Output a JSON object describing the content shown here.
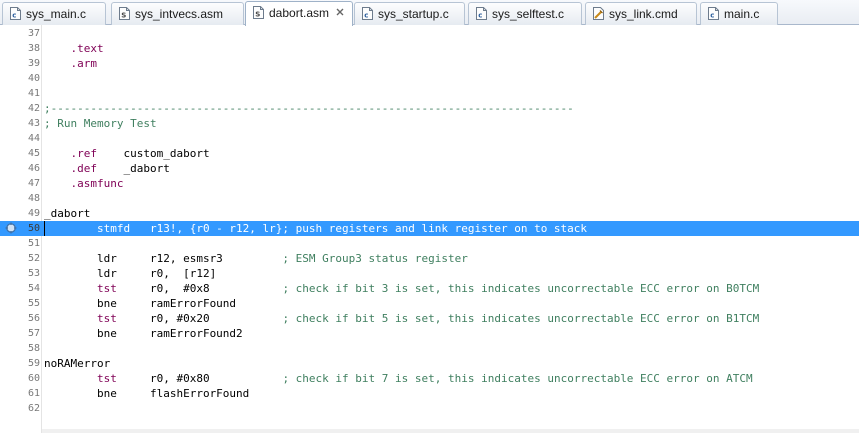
{
  "tabs": [
    {
      "label": "sys_main.c",
      "icon": "c-file-icon",
      "active": false,
      "closable": false
    },
    {
      "label": "sys_intvecs.asm",
      "icon": "asm-file-icon",
      "active": false,
      "closable": false
    },
    {
      "label": "dabort.asm",
      "icon": "asm-file-icon",
      "active": true,
      "closable": true
    },
    {
      "label": "sys_startup.c",
      "icon": "c-file-icon",
      "active": false,
      "closable": false
    },
    {
      "label": "sys_selftest.c",
      "icon": "c-file-icon",
      "active": false,
      "closable": false
    },
    {
      "label": "sys_link.cmd",
      "icon": "linker-cmd-file-icon",
      "active": false,
      "closable": false
    },
    {
      "label": "main.c",
      "icon": "c-file-icon",
      "active": false,
      "closable": false
    }
  ],
  "colors": {
    "directive": "#7f0055",
    "comment": "#3f7f5f",
    "current_line_highlight": "#3399ff",
    "line_number": "#787878"
  },
  "editor": {
    "current_line": 50,
    "marker_line": 50,
    "marker_icon": "debug-location-icon",
    "lines": [
      {
        "num": "37",
        "segments": []
      },
      {
        "num": "38",
        "segments": [
          {
            "t": "    "
          },
          {
            "t": ".text",
            "k": "dir"
          }
        ]
      },
      {
        "num": "39",
        "segments": [
          {
            "t": "    "
          },
          {
            "t": ".arm",
            "k": "dir"
          }
        ]
      },
      {
        "num": "40",
        "segments": []
      },
      {
        "num": "41",
        "segments": []
      },
      {
        "num": "42",
        "segments": [
          {
            "t": ";-------------------------------------------------------------------------------",
            "k": "cmt"
          }
        ]
      },
      {
        "num": "43",
        "segments": [
          {
            "t": "; Run Memory Test",
            "k": "cmt"
          }
        ]
      },
      {
        "num": "44",
        "segments": []
      },
      {
        "num": "45",
        "segments": [
          {
            "t": "    "
          },
          {
            "t": ".ref",
            "k": "dir"
          },
          {
            "t": "    custom_dabort"
          }
        ]
      },
      {
        "num": "46",
        "segments": [
          {
            "t": "    "
          },
          {
            "t": ".def",
            "k": "dir"
          },
          {
            "t": "    _dabort"
          }
        ]
      },
      {
        "num": "47",
        "segments": [
          {
            "t": "    "
          },
          {
            "t": ".asmfunc",
            "k": "dir"
          }
        ]
      },
      {
        "num": "48",
        "segments": []
      },
      {
        "num": "49",
        "segments": [
          {
            "t": "_dabort"
          }
        ]
      },
      {
        "num": "50",
        "segments": [
          {
            "t": "        stmfd   r13!, {r0 - r12, lr}; push registers and link register on to stack"
          }
        ]
      },
      {
        "num": "51",
        "segments": []
      },
      {
        "num": "52",
        "segments": [
          {
            "t": "        ldr     r12, esmsr3         "
          },
          {
            "t": "; ESM Group3 status register",
            "k": "cmt"
          }
        ]
      },
      {
        "num": "53",
        "segments": [
          {
            "t": "        ldr     r0,  [r12]"
          }
        ]
      },
      {
        "num": "54",
        "segments": [
          {
            "t": "        tst",
            "k": "dir"
          },
          {
            "t": "     r0,  #0x8           "
          },
          {
            "t": "; check if bit 3 is set, this indicates uncorrectable ECC error on B0TCM",
            "k": "cmt"
          }
        ]
      },
      {
        "num": "55",
        "segments": [
          {
            "t": "        bne     ramErrorFound"
          }
        ]
      },
      {
        "num": "56",
        "segments": [
          {
            "t": "        tst",
            "k": "dir"
          },
          {
            "t": "     r0, #0x20           "
          },
          {
            "t": "; check if bit 5 is set, this indicates uncorrectable ECC error on B1TCM",
            "k": "cmt"
          }
        ]
      },
      {
        "num": "57",
        "segments": [
          {
            "t": "        bne     ramErrorFound2"
          }
        ]
      },
      {
        "num": "58",
        "segments": []
      },
      {
        "num": "59",
        "segments": [
          {
            "t": "noRAMerror"
          }
        ]
      },
      {
        "num": "60",
        "segments": [
          {
            "t": "        tst",
            "k": "dir"
          },
          {
            "t": "     r0, #0x80           "
          },
          {
            "t": "; check if bit 7 is set, this indicates uncorrectable ECC error on ATCM",
            "k": "cmt"
          }
        ]
      },
      {
        "num": "61",
        "segments": [
          {
            "t": "        bne     flashErrorFound"
          }
        ]
      },
      {
        "num": "62",
        "segments": []
      }
    ]
  }
}
